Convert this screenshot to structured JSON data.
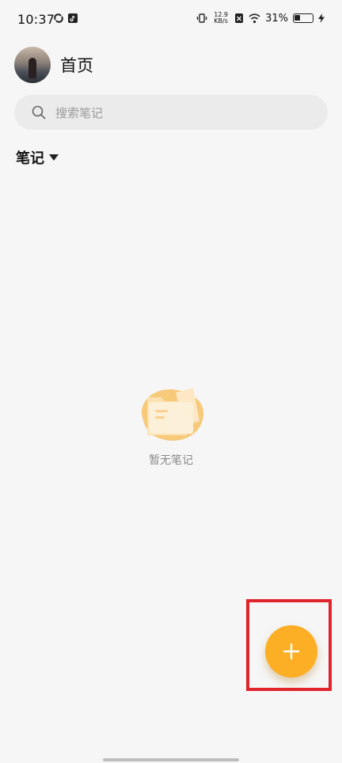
{
  "status_bar": {
    "time": "10:37",
    "net_speed_value": "12.9",
    "net_speed_unit": "KB/s",
    "battery_percent": "31%",
    "battery_level": 0.31
  },
  "header": {
    "title": "首页"
  },
  "search": {
    "placeholder": "搜索笔记"
  },
  "filter": {
    "label": "笔记"
  },
  "empty_state": {
    "message": "暂无笔记"
  },
  "colors": {
    "accent": "#fcae24",
    "background": "#f6f6f6",
    "highlight": "#e0242b"
  },
  "icons": {
    "search": "search-icon",
    "caret": "caret-down-icon",
    "add": "plus-icon",
    "empty": "empty-folder-icon"
  }
}
